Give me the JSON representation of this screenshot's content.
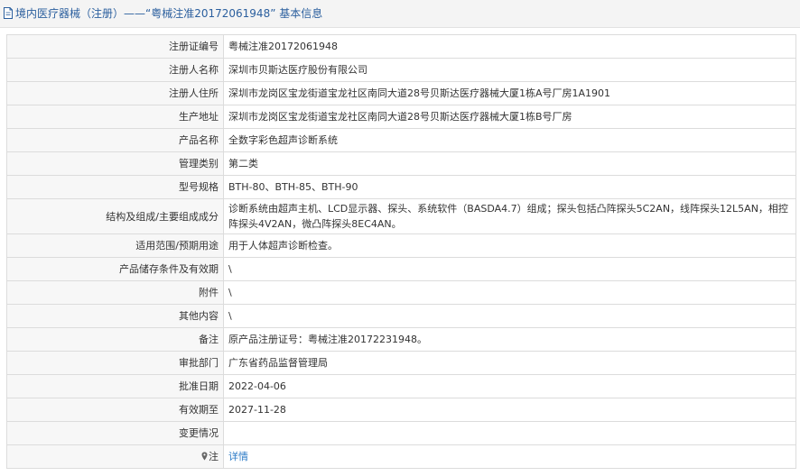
{
  "header": {
    "title": "境内医疗器械（注册）——“粤械注准20172061948” 基本信息"
  },
  "rows": [
    {
      "label": "注册证编号",
      "value": "粤械注准20172061948"
    },
    {
      "label": "注册人名称",
      "value": "深圳市贝斯达医疗股份有限公司"
    },
    {
      "label": "注册人住所",
      "value": "深圳市龙岗区宝龙街道宝龙社区南同大道28号贝斯达医疗器械大厦1栋A号厂房1A1901"
    },
    {
      "label": "生产地址",
      "value": "深圳市龙岗区宝龙街道宝龙社区南同大道28号贝斯达医疗器械大厦1栋B号厂房"
    },
    {
      "label": "产品名称",
      "value": "全数字彩色超声诊断系统"
    },
    {
      "label": "管理类别",
      "value": "第二类"
    },
    {
      "label": "型号规格",
      "value": "BTH-80、BTH-85、BTH-90"
    },
    {
      "label": "结构及组成/主要组成成分",
      "value": "诊断系统由超声主机、LCD显示器、探头、系统软件（BASDA4.7）组成；探头包括凸阵探头5C2AN，线阵探头12L5AN，相控阵探头4V2AN，微凸阵探头8EC4AN。"
    },
    {
      "label": "适用范围/预期用途",
      "value": "用于人体超声诊断检查。"
    },
    {
      "label": "产品储存条件及有效期",
      "value": "\\"
    },
    {
      "label": "附件",
      "value": "\\"
    },
    {
      "label": "其他内容",
      "value": "\\"
    },
    {
      "label": "备注",
      "value": "原产品注册证号：粤械注准20172231948。"
    },
    {
      "label": "审批部门",
      "value": "广东省药品监督管理局"
    },
    {
      "label": "批准日期",
      "value": "2022-04-06"
    },
    {
      "label": "有效期至",
      "value": "2027-11-28"
    },
    {
      "label": "变更情况",
      "value": ""
    }
  ],
  "note": {
    "label": "注",
    "link": "详情",
    "icon": "location-pin-icon"
  }
}
